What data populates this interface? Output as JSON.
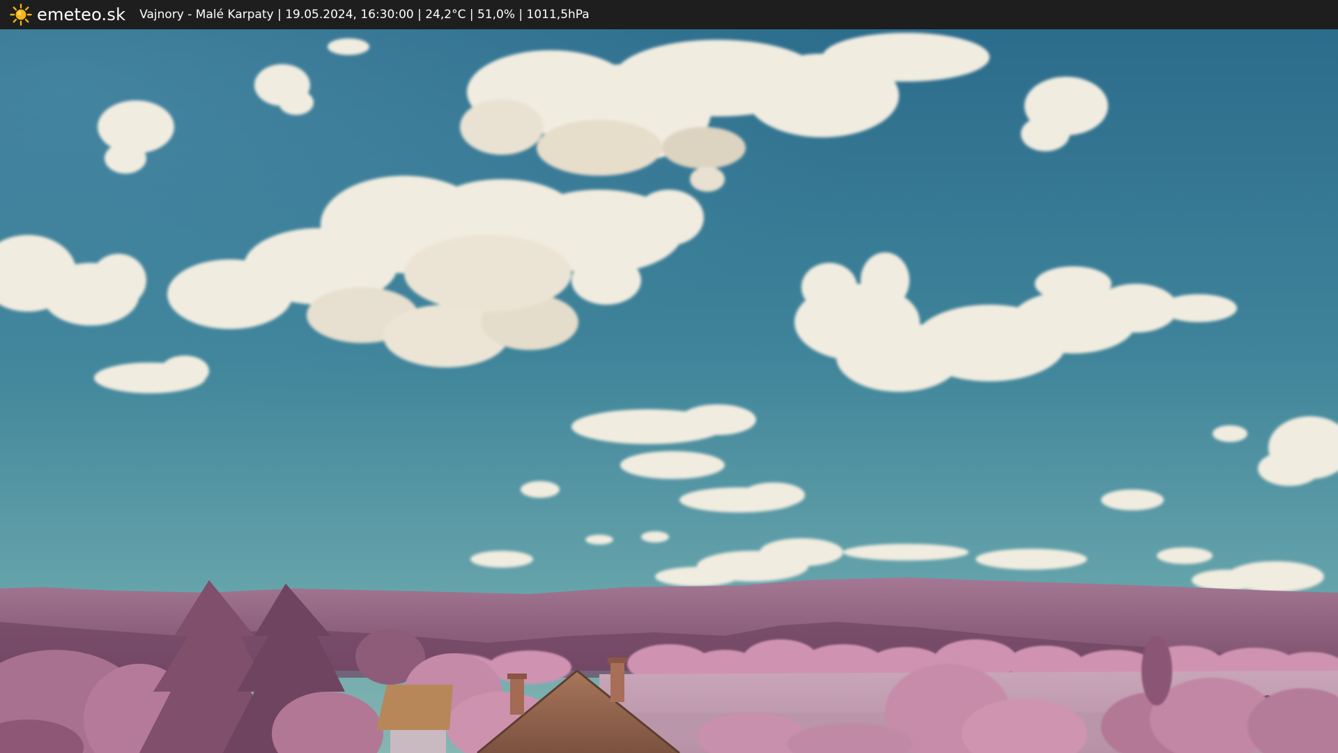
{
  "header": {
    "brand": "emeteo.sk",
    "logo_icon": "sun-icon",
    "info_line": "Vajnory - Malé Karpaty | 19.05.2024, 16:30:00 | 24,2°C | 51,0% | 1011,5hPa"
  },
  "colors": {
    "header_bg": "#1e1e1e",
    "sun": "#f4b41a",
    "sky_top": "#2d6f8e",
    "sky_horizon": "#6aa7ad",
    "cloud": "#f1ece0",
    "hills": "#8e5f7c",
    "trees": "#c88ba8"
  }
}
